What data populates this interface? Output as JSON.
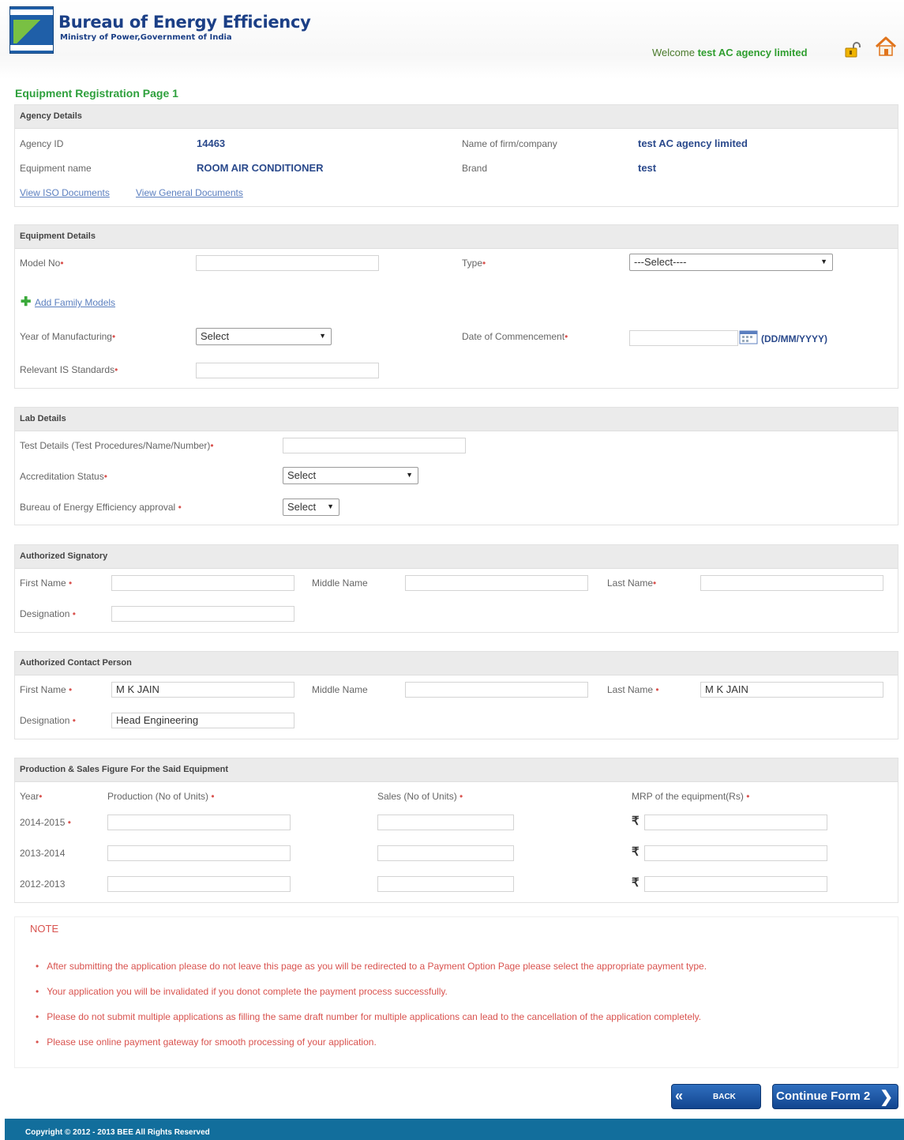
{
  "header": {
    "brand_title": "Bureau of Energy Efficiency",
    "brand_subtitle": "Ministry of Power,Government of India",
    "welcome_text": "Welcome",
    "user_name": "test AC agency limited"
  },
  "page_title": "Equipment Registration Page 1",
  "agency": {
    "heading": "Agency Details",
    "agency_id_label": "Agency ID",
    "agency_id": "14463",
    "firm_label": "Name of firm/company",
    "firm_value": "test AC agency limited",
    "equipment_label": "Equipment name",
    "equipment_value": "ROOM AIR CONDITIONER",
    "brand_label": "Brand",
    "brand_value": "test",
    "iso_link": "View ISO Documents",
    "general_link": "View General Documents"
  },
  "equipment": {
    "heading": "Equipment Details",
    "model_label": "Model No",
    "type_label": "Type",
    "type_value": "---Select----",
    "add_family": "Add Family Models",
    "year_label": "Year of Manufacturing",
    "year_value": "Select",
    "commence_label": "Date of Commencement",
    "date_format": "(DD/MM/YYYY)",
    "is_label": "Relevant IS Standards"
  },
  "lab": {
    "heading": "Lab Details",
    "test_label": "Test Details (Test Procedures/Name/Number)",
    "accred_label": "Accreditation Status",
    "accred_value": "Select",
    "bee_label": "Bureau of Energy Efficiency approval",
    "bee_value": "Select"
  },
  "signatory": {
    "heading": "Authorized Signatory",
    "first_label": "First Name",
    "middle_label": "Middle Name",
    "last_label": "Last Name",
    "desig_label": "Designation",
    "first_value": "",
    "middle_value": "",
    "last_value": "",
    "desig_value": ""
  },
  "contact": {
    "heading": "Authorized Contact Person",
    "first_label": "First Name",
    "middle_label": "Middle Name",
    "last_label": "Last Name",
    "desig_label": "Designation",
    "first_value": "M K JAIN",
    "middle_value": "",
    "last_value": "M K JAIN",
    "desig_value": "Head Engineering"
  },
  "production": {
    "heading": "Production & Sales Figure For the Said Equipment",
    "col_year": "Year",
    "col_production": "Production (No of Units)",
    "col_sales": "Sales (No of Units)",
    "col_mrp": "MRP of the equipment(Rs)",
    "rupee": "₹",
    "rows": [
      "2014-2015",
      "2013-2014",
      "2012-2013"
    ]
  },
  "note": {
    "title": "NOTE",
    "items": [
      "After submitting the application please do not leave this page as you will be redirected to a Payment Option Page please select the appropriate payment type.",
      "Your application you will be invalidated if you donot complete the payment process successfully.",
      "Please do not submit multiple applications as filling the same draft number for multiple applications can lead to the cancellation of the application completely.",
      "Please use online payment gateway for smooth processing of your application."
    ]
  },
  "buttons": {
    "back": "BACK",
    "continue": "Continue Form 2"
  },
  "footer": "Copyright © 2012 - 2013 BEE All Rights Reserved",
  "colors": {
    "brand_blue": "#1b3f86",
    "title_green": "#2ea03c",
    "required_red": "#d9534f",
    "footer_teal": "#126e9c"
  }
}
